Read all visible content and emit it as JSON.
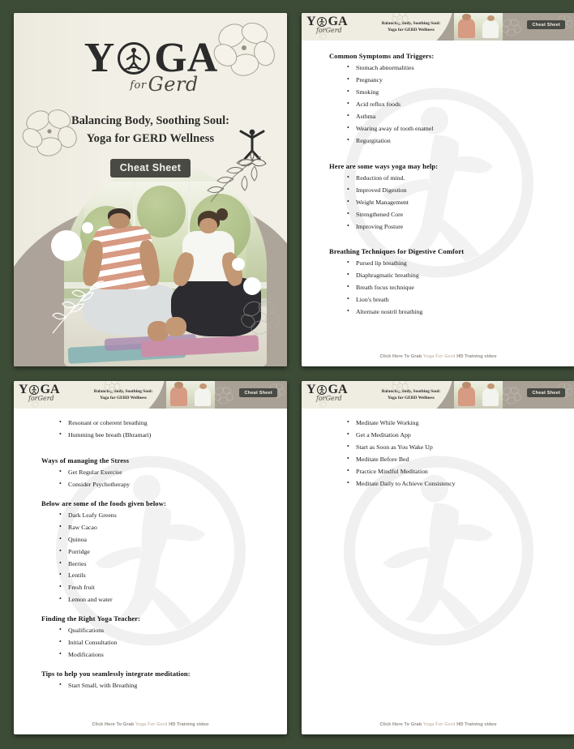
{
  "brand": {
    "logo_y": "Y",
    "logo_g": "G",
    "logo_a": "A",
    "logo_script_small": "for",
    "logo_script_main": "Gerd",
    "emblem_icon": "yoga-pose-in-circle-icon"
  },
  "colors": {
    "background": "#3d4c37",
    "cover_bg": "#f0eee3",
    "badge_bg": "#4a4a45",
    "header_band": "#efede1",
    "header_wave": "#a9a096",
    "footer_link": "#c9bfae",
    "text": "#1a1a1a"
  },
  "cover": {
    "subtitle_line1": "Balancing Body, Soothing Soul:",
    "subtitle_line2": "Yoga for GERD Wellness",
    "badge": "Cheat Sheet",
    "photo_alt": "man-and-woman-meditating-photo"
  },
  "header": {
    "subtitle_line1": "Balancing Body, Soothing Soul:",
    "subtitle_line2": "Yoga for GERD Wellness",
    "badge": "Cheat Sheet"
  },
  "footer": {
    "prefix": "Click Here To Grab ",
    "highlight": "Yoga For Gerd ",
    "suffix": "HD Training video"
  },
  "pages": [
    {
      "id": "page-2",
      "sections": [
        {
          "title": "Common Symptoms and Triggers:",
          "items": [
            "Stomach abnormalities",
            "Pregnancy",
            "Smoking",
            "Acid reflux foods",
            "Asthma",
            "Wearing away of tooth enamel",
            "Regurgitation"
          ]
        },
        {
          "title": "Here are some ways yoga may help:",
          "items": [
            "Reduction of mind.",
            "Improved Digestion",
            "Weight Management",
            "Strengthened Core",
            "Improving Posture"
          ]
        },
        {
          "title": "Breathing Techniques for Digestive Comfort",
          "items": [
            "Pursed lip breathing",
            "Diaphragmatic breathing",
            "Breath focus technique",
            "Lion's breath",
            "Alternate nostril breathing"
          ]
        }
      ]
    },
    {
      "id": "page-3",
      "sections": [
        {
          "title": "",
          "items": [
            "Resonant or coherent breathing",
            "Humming bee breath (Bhramari)"
          ]
        },
        {
          "title": "Ways of managing the Stress",
          "items": [
            "Get Regular Exercise",
            "Consider Psychotherapy"
          ]
        },
        {
          "title": "Below are some of the foods given below:",
          "items": [
            "Dark Leafy Greens",
            "Raw Cacao",
            "Quinoa",
            "Porridge",
            "Berries",
            "Lentils",
            "Fresh fruit",
            "Lemon and water"
          ]
        },
        {
          "title": "Finding the Right Yoga Teacher:",
          "items": [
            "Qualifications",
            "Initial Consultation",
            "Modifications"
          ]
        },
        {
          "title": "Tips to help you seamlessly integrate meditation:",
          "items": [
            "Start Small, with Breathing"
          ]
        }
      ]
    },
    {
      "id": "page-4",
      "sections": [
        {
          "title": "",
          "items": [
            "Meditate While Working",
            "Get a Meditation App",
            "Start as Soon as You Wake Up",
            "Meditate Before Bed",
            "Practice Mindful Meditation",
            "Meditate Daily to Achieve Consistency"
          ]
        }
      ]
    }
  ]
}
